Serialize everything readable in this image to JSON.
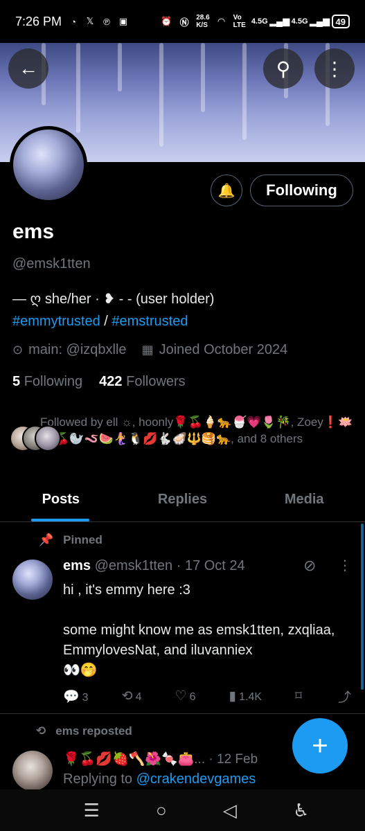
{
  "status": {
    "time": "7:26 PM",
    "left_icons": [
      "whatsapp-icon",
      "x-icon",
      "pinterest-icon",
      "office-icon"
    ],
    "speed_value": "28.6",
    "speed_unit": "K/S",
    "volte_1": "Vo",
    "volte_2": "LTE",
    "net_1": "4.5G",
    "net_2": "4.5G",
    "battery": "49"
  },
  "header": {
    "back_icon": "back-arrow-icon",
    "search_icon": "search-icon",
    "more_icon": "more-vertical-icon"
  },
  "profile": {
    "name": "ems",
    "handle": "@emsk1tten",
    "bio_line1": "— ღ she/her · ❥ - - (user holder)",
    "tag1": "#emmytrusted",
    "tag_sep": " / ",
    "tag2": "#emstrusted",
    "location": "main: @izqbxlle",
    "joined": "Joined October 2024",
    "following_count": "5",
    "following_label": "Following",
    "followers_count": "422",
    "followers_label": "Followers",
    "follow_button": "Following",
    "followed_by": "Followed by ell ☼, hoonly🌹🍒🍦🐆🍧💗🌷🎋, Zoey❗️🪷🐈🍒🦭🪱🍉🧜‍♀️🐧💋🐇🦪🔱🥞🐆, and 8 others"
  },
  "tabs": [
    {
      "label": "Posts",
      "active": true
    },
    {
      "label": "Replies",
      "active": false
    },
    {
      "label": "Media",
      "active": false
    }
  ],
  "pinned_post": {
    "pinned_label": "Pinned",
    "name": "ems",
    "handle": "@emsk1tten",
    "date": "· 17 Oct 24",
    "body": "hi , it's emmy here :3\n\nsome might know me as emsk1tten, zxqliaa, EmmylovesNat, and iluvanniex\n👀🤭",
    "replies": "3",
    "reposts": "4",
    "likes": "6",
    "views": "1.4K"
  },
  "repost": {
    "label": "ems reposted",
    "name": "🌹🍒💋🍓🪓🌺🍬👛...",
    "date": "· 12 Feb",
    "reply_prefix": "Replying to ",
    "reply_to": "@crakendevgames"
  },
  "fab_label": "+",
  "nav": [
    "recents-icon",
    "home-icon",
    "back-icon",
    "accessibility-icon"
  ]
}
